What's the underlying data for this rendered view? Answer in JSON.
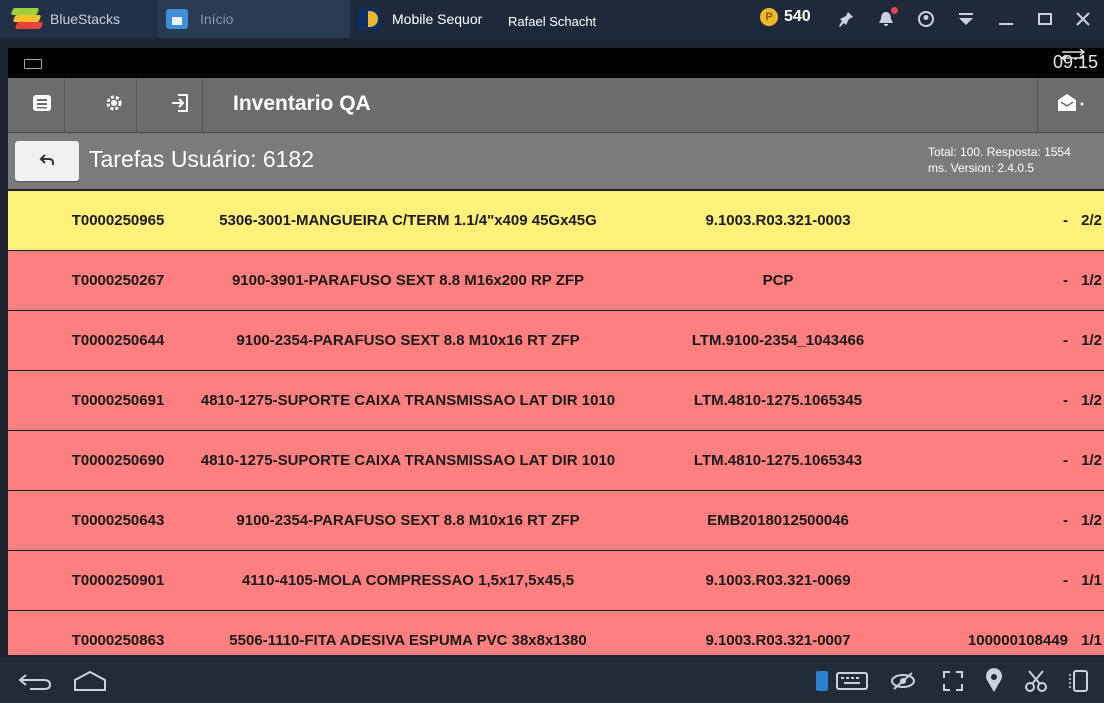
{
  "window": {
    "tabs": [
      {
        "label": "BlueStacks"
      },
      {
        "label": "Início"
      },
      {
        "label": "Mobile Sequor"
      }
    ],
    "user_name": "Rafael Schacht",
    "coins": "540",
    "accent": "#1e2a3c"
  },
  "statusbar": {
    "time": "09:15"
  },
  "toolbar": {
    "title": "Inventario QA"
  },
  "subheader": {
    "title": "Tarefas Usuário: 6182",
    "meta_line1": "Total: 100. Resposta: 1554",
    "meta_line2": "ms. Version: 2.4.0.5"
  },
  "tasks": [
    {
      "task": "T0000250965",
      "description": "5306-3001-MANGUEIRA C/TERM 1.1/4\"x409 45Gx45G",
      "location": "9.1003.R03.321-0003",
      "lot": "-",
      "count": "2/2",
      "color": "#fef17a"
    },
    {
      "task": "T0000250267",
      "description": "9100-3901-PARAFUSO SEXT 8.8 M16x200 RP ZFP",
      "location": "PCP",
      "lot": "-",
      "count": "1/2",
      "color": "#fe7f7f"
    },
    {
      "task": "T0000250644",
      "description": "9100-2354-PARAFUSO SEXT 8.8 M10x16 RT ZFP",
      "location": "LTM.9100-2354_1043466",
      "lot": "-",
      "count": "1/2",
      "color": "#fe7f7f"
    },
    {
      "task": "T0000250691",
      "description": "4810-1275-SUPORTE CAIXA TRANSMISSAO LAT DIR 1010",
      "location": "LTM.4810-1275.1065345",
      "lot": "-",
      "count": "1/2",
      "color": "#fe7f7f"
    },
    {
      "task": "T0000250690",
      "description": "4810-1275-SUPORTE CAIXA TRANSMISSAO LAT DIR 1010",
      "location": "LTM.4810-1275.1065343",
      "lot": "-",
      "count": "1/2",
      "color": "#fe7f7f"
    },
    {
      "task": "T0000250643",
      "description": "9100-2354-PARAFUSO SEXT 8.8 M10x16 RT ZFP",
      "location": "EMB2018012500046",
      "lot": "-",
      "count": "1/2",
      "color": "#fe7f7f"
    },
    {
      "task": "T0000250901",
      "description": "4110-4105-MOLA COMPRESSAO 1,5x17,5x45,5",
      "location": "9.1003.R03.321-0069",
      "lot": "-",
      "count": "1/1",
      "color": "#fe7f7f"
    },
    {
      "task": "T0000250863",
      "description": "5506-1110-FITA ADESIVA ESPUMA PVC 38x8x1380",
      "location": "9.1003.R03.321-0007",
      "lot": "100000108449",
      "count": "1/1",
      "color": "#fe7f7f"
    }
  ],
  "icons": {
    "toolbar": [
      "menu-icon",
      "settings-icon",
      "logout-icon",
      "mail-icon"
    ],
    "navbar": [
      "back-icon",
      "home-icon",
      "keyboard-icon",
      "hide-icon",
      "fullscreen-icon",
      "location-icon",
      "cut-icon",
      "rotate-icon"
    ]
  }
}
